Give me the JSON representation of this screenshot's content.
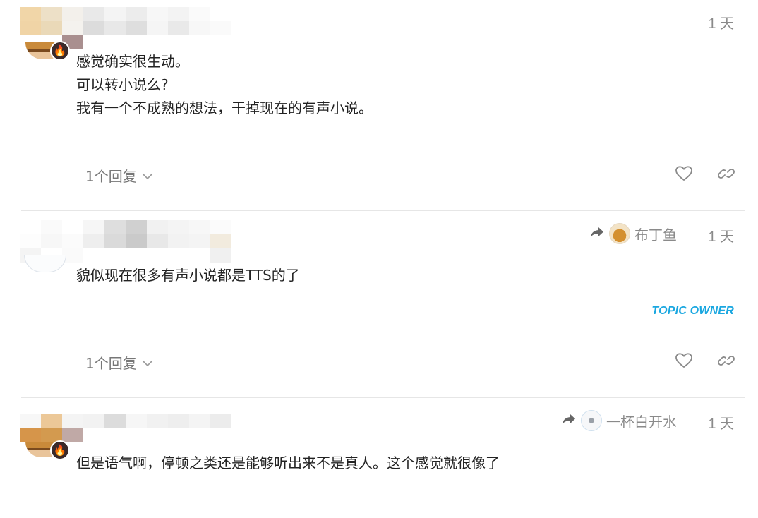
{
  "posts": [
    {
      "date": "1 天",
      "lines": [
        "感觉确实很生动。",
        "可以转小说么?",
        "我有一个不成熟的想法，干掉现在的有声小说。"
      ],
      "replies_label": "1个回复"
    },
    {
      "reply_to_name": "布丁鱼",
      "date": "1 天",
      "lines": [
        "貌似现在很多有声小说都是TTS的了"
      ],
      "badge": "TOPIC OWNER",
      "replies_label": "1个回复"
    },
    {
      "reply_to_name": "一杯白开水",
      "date": "1 天",
      "lines": [
        "但是语气啊，停顿之类还是能够听出来不是真人。这个感觉就很像了"
      ]
    }
  ],
  "icons": {
    "like": "heart-icon",
    "link": "link-icon",
    "reply_arrow": "share-arrow-icon",
    "expand": "chevron-down-icon",
    "badge": "fire-icon"
  },
  "colors": {
    "topic_owner": "#1aa7e0",
    "muted_text": "#8a8a8a",
    "body_text": "#222222",
    "divider": "#e6e6e6"
  }
}
